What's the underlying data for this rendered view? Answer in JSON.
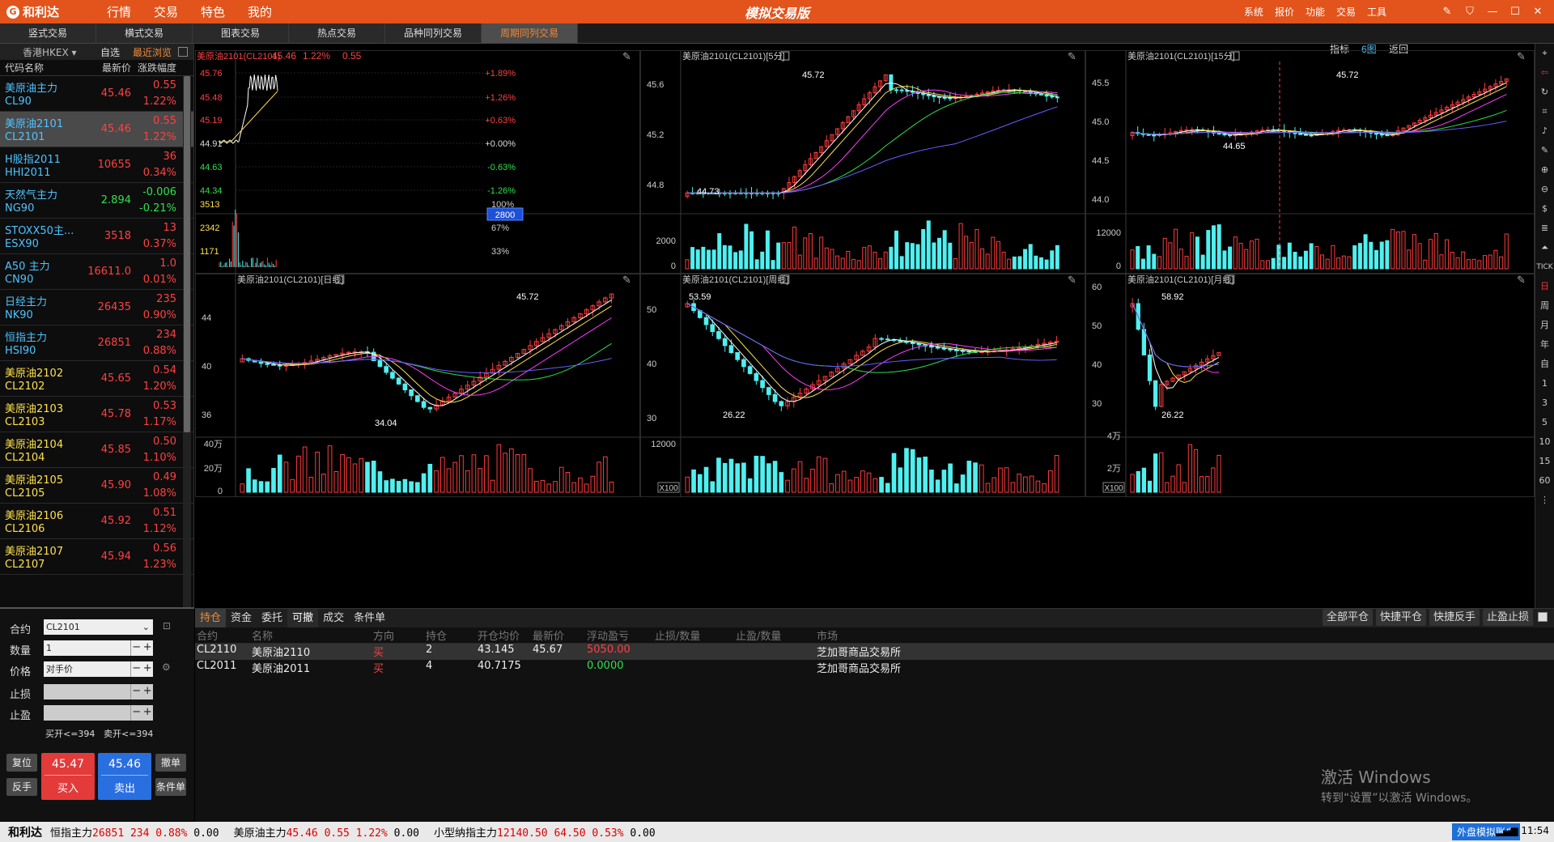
{
  "titlebar": {
    "logo": "和利达",
    "menus": [
      "行情",
      "交易",
      "特色",
      "我的"
    ],
    "title": "模拟交易版",
    "sys_menus": [
      "系统",
      "报价",
      "功能",
      "交易",
      "工具"
    ]
  },
  "tabs": [
    "竖式交易",
    "横式交易",
    "图表交易",
    "热点交易",
    "品种同列交易",
    "周期同列交易"
  ],
  "quote": {
    "market": "香港HKEX",
    "fav": "自选",
    "recent": "最近浏览",
    "headers": [
      "代码名称",
      "最新价",
      "涨跌幅度"
    ],
    "rows": [
      {
        "name": "美原油主力",
        "code": "CL90",
        "price": "45.46",
        "chg": "0.55",
        "pct": "1.22%",
        "dir": "up"
      },
      {
        "name": "美原油2101",
        "code": "CL2101",
        "price": "45.46",
        "chg": "0.55",
        "pct": "1.22%",
        "dir": "up"
      },
      {
        "name": "H股指2011",
        "code": "HHI2011",
        "price": "10655",
        "chg": "36",
        "pct": "0.34%",
        "dir": "up"
      },
      {
        "name": "天然气主力",
        "code": "NG90",
        "price": "2.894",
        "chg": "-0.006",
        "pct": "-0.21%",
        "dir": "dn"
      },
      {
        "name": "STOXX50主...",
        "code": "ESX90",
        "price": "3518",
        "chg": "13",
        "pct": "0.37%",
        "dir": "up"
      },
      {
        "name": "A50 主力",
        "code": "CN90",
        "price": "16611.0",
        "chg": "1.0",
        "pct": "0.01%",
        "dir": "up"
      },
      {
        "name": "日经主力",
        "code": "NK90",
        "price": "26435",
        "chg": "235",
        "pct": "0.90%",
        "dir": "up"
      },
      {
        "name": "恒指主力",
        "code": "HSI90",
        "price": "26851",
        "chg": "234",
        "pct": "0.88%",
        "dir": "up"
      },
      {
        "name": "美原油2102",
        "code": "CL2102",
        "price": "45.65",
        "chg": "0.54",
        "pct": "1.20%",
        "dir": "up"
      },
      {
        "name": "美原油2103",
        "code": "CL2103",
        "price": "45.78",
        "chg": "0.53",
        "pct": "1.17%",
        "dir": "up"
      },
      {
        "name": "美原油2104",
        "code": "CL2104",
        "price": "45.85",
        "chg": "0.50",
        "pct": "1.10%",
        "dir": "up"
      },
      {
        "name": "美原油2105",
        "code": "CL2105",
        "price": "45.90",
        "chg": "0.49",
        "pct": "1.08%",
        "dir": "up"
      },
      {
        "name": "美原油2106",
        "code": "CL2106",
        "price": "45.92",
        "chg": "0.51",
        "pct": "1.12%",
        "dir": "up"
      },
      {
        "name": "美原油2107",
        "code": "CL2107",
        "price": "45.94",
        "chg": "0.56",
        "pct": "1.23%",
        "dir": "up"
      }
    ]
  },
  "order": {
    "contract_label": "合约",
    "contract": "CL2101",
    "qty_label": "数量",
    "qty": "1",
    "price_label": "价格",
    "price": "对手价",
    "sl_label": "止损",
    "tp_label": "止盈",
    "buy_limit": "买开<=394",
    "sell_limit": "卖开<=394",
    "reset": "复位",
    "reverse": "反手",
    "buy_price": "45.47",
    "buy_label": "买入",
    "sell_price": "45.46",
    "sell_label": "卖出",
    "cancel": "撤单",
    "cond": "条件单"
  },
  "charts": {
    "toolbar": {
      "indicator": "指标",
      "six": "6图",
      "back": "返回"
    },
    "intraday": {
      "title": "美原油2101(CL2101)",
      "price": "45.46",
      "pct": "1.22%",
      "chg": "0.55",
      "left": [
        "45.76",
        "45.48",
        "45.19",
        "44.91",
        "44.63",
        "44.34"
      ],
      "right": [
        "+1.89%",
        "+1.26%",
        "+0.63%",
        "+0.00%",
        "-0.63%",
        "-1.26%"
      ],
      "vol_left": [
        "3513",
        "2342",
        "1171"
      ],
      "vol_right": [
        "100%",
        "67%",
        "33%"
      ],
      "cursor": "2800"
    },
    "m5": {
      "title": "美原油2101(CL2101)[5分]",
      "y": [
        "45.6",
        "45.2",
        "44.8"
      ],
      "hi": "45.72",
      "lo": "44.73",
      "vol": [
        "2000",
        "0"
      ]
    },
    "m15": {
      "title": "美原油2101(CL2101)[15分]",
      "y": [
        "45.5",
        "45.0",
        "44.5",
        "44.0"
      ],
      "hi": "45.72",
      "lo": "44.65",
      "vol": [
        "12000",
        "0"
      ]
    },
    "day": {
      "title": "美原油2101(CL2101)[日线]",
      "y": [
        "44",
        "40",
        "36"
      ],
      "hi": "45.72",
      "lo": "34.04",
      "vol": [
        "40万",
        "20万",
        "0"
      ]
    },
    "week": {
      "title": "美原油2101(CL2101)[周线]",
      "y": [
        "50",
        "40",
        "30"
      ],
      "hi": "53.59",
      "lo": "26.22",
      "vol": [
        "12000"
      ],
      "x": "X100"
    },
    "month": {
      "title": "美原油2101(CL2101)[月线]",
      "y": [
        "60",
        "50",
        "40",
        "30"
      ],
      "hi": "58.92",
      "lo": "26.22",
      "vol": [
        "4万",
        "2万"
      ],
      "x": "X100"
    }
  },
  "right_tools": [
    "周",
    "月",
    "年",
    "自",
    "1",
    "3",
    "5",
    "10",
    "15",
    "60",
    "TICK",
    "日"
  ],
  "bottom": {
    "tabs": [
      "持仓",
      "资金",
      "委托",
      "可撤",
      "成交",
      "条件单"
    ],
    "actions": [
      "全部平仓",
      "快捷平仓",
      "快捷反手",
      "止盈止损"
    ],
    "headers": [
      "合约",
      "名称",
      "方向",
      "持仓",
      "开仓均价",
      "最新价",
      "浮动盈亏",
      "止损/数量",
      "止盈/数量",
      "市场"
    ],
    "rows": [
      {
        "code": "CL2110",
        "name": "美原油2110",
        "dir": "买",
        "qty": "2",
        "avg": "43.145",
        "last": "45.67",
        "pnl": "5050.00",
        "sl": "",
        "tp": "",
        "market": "芝加哥商品交易所"
      },
      {
        "code": "CL2011",
        "name": "美原油2011",
        "dir": "买",
        "qty": "4",
        "avg": "40.7175",
        "last": "",
        "pnl": "0.0000",
        "sl": "",
        "tp": "",
        "market": "芝加哥商品交易所"
      }
    ]
  },
  "watermark": {
    "line1": "激活 Windows",
    "line2": "转到“设置”以激活 Windows。"
  },
  "statusbar": {
    "logo": "和利达",
    "tickers": [
      {
        "name": "恒指主力",
        "price": "26851",
        "chg": "234",
        "pct": "0.88%",
        "vol": "0.00"
      },
      {
        "name": "美原油主力",
        "price": "45.46",
        "chg": "0.55",
        "pct": "1.22%",
        "vol": "0.00"
      },
      {
        "name": "小型纳指主力",
        "price": "12140.50",
        "chg": "64.50",
        "pct": "0.53%",
        "vol": "0.00"
      }
    ],
    "account": "外盘模拟账户",
    "time": "11:54"
  }
}
